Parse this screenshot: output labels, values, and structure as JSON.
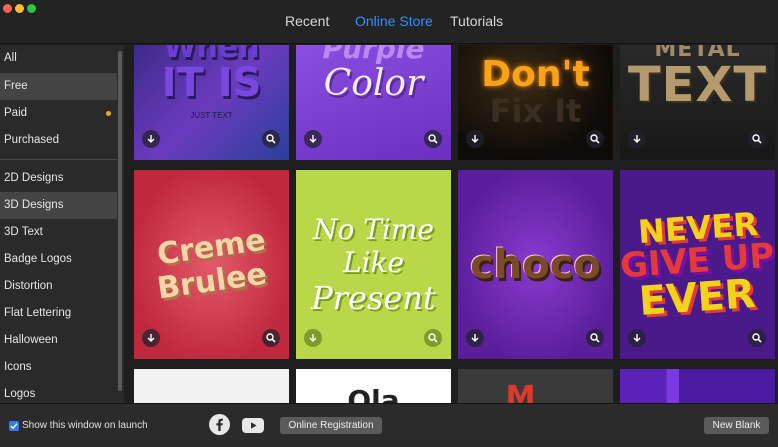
{
  "tabs": [
    {
      "label": "Recent",
      "active": false
    },
    {
      "label": "Online Store",
      "active": true
    },
    {
      "label": "Tutorials",
      "active": false
    }
  ],
  "sidebar": {
    "items": [
      {
        "label": "All"
      },
      {
        "label": "Free",
        "selected": true
      },
      {
        "label": "Paid",
        "badge_dot": true
      },
      {
        "label": "Purchased"
      },
      {
        "label": "2D Designs"
      },
      {
        "label": "3D Designs",
        "selected": true
      },
      {
        "label": "3D Text"
      },
      {
        "label": "Badge Logos"
      },
      {
        "label": "Distortion"
      },
      {
        "label": "Flat Lettering"
      },
      {
        "label": "Halloween"
      },
      {
        "label": "Icons"
      },
      {
        "label": "Logos"
      }
    ]
  },
  "cards": [
    {
      "art_lines": [
        "When",
        "IT IS"
      ],
      "caption": "JUST TEXT"
    },
    {
      "art_lines": [
        "Purple",
        "Color"
      ]
    },
    {
      "art_lines": [
        "Don't",
        "Fix It"
      ]
    },
    {
      "art_lines": [
        "METAL",
        "TEXT"
      ]
    },
    {
      "art_lines": [
        "Creme",
        "Brulee"
      ]
    },
    {
      "art_lines": [
        "No Time",
        "Like",
        "Present"
      ]
    },
    {
      "art_lines": [
        "choco"
      ]
    },
    {
      "art_lines": [
        "NEVER",
        "GIVE UP",
        "EVER"
      ]
    },
    {
      "art_lines": []
    },
    {
      "art_lines": [
        "Ola"
      ]
    },
    {
      "art_lines": [
        "M"
      ]
    },
    {
      "art_lines": []
    }
  ],
  "bottom": {
    "show_on_launch_label": "Show this window on launch",
    "show_on_launch_checked": true,
    "registration_label": "Online Registration",
    "new_blank_label": "New Blank"
  },
  "icons": {
    "download": "download-arrow-icon",
    "zoom": "magnifier-icon",
    "facebook": "facebook-icon",
    "youtube": "youtube-icon"
  },
  "colors": {
    "accent": "#2f8fff",
    "paid_dot": "#f5a524"
  }
}
